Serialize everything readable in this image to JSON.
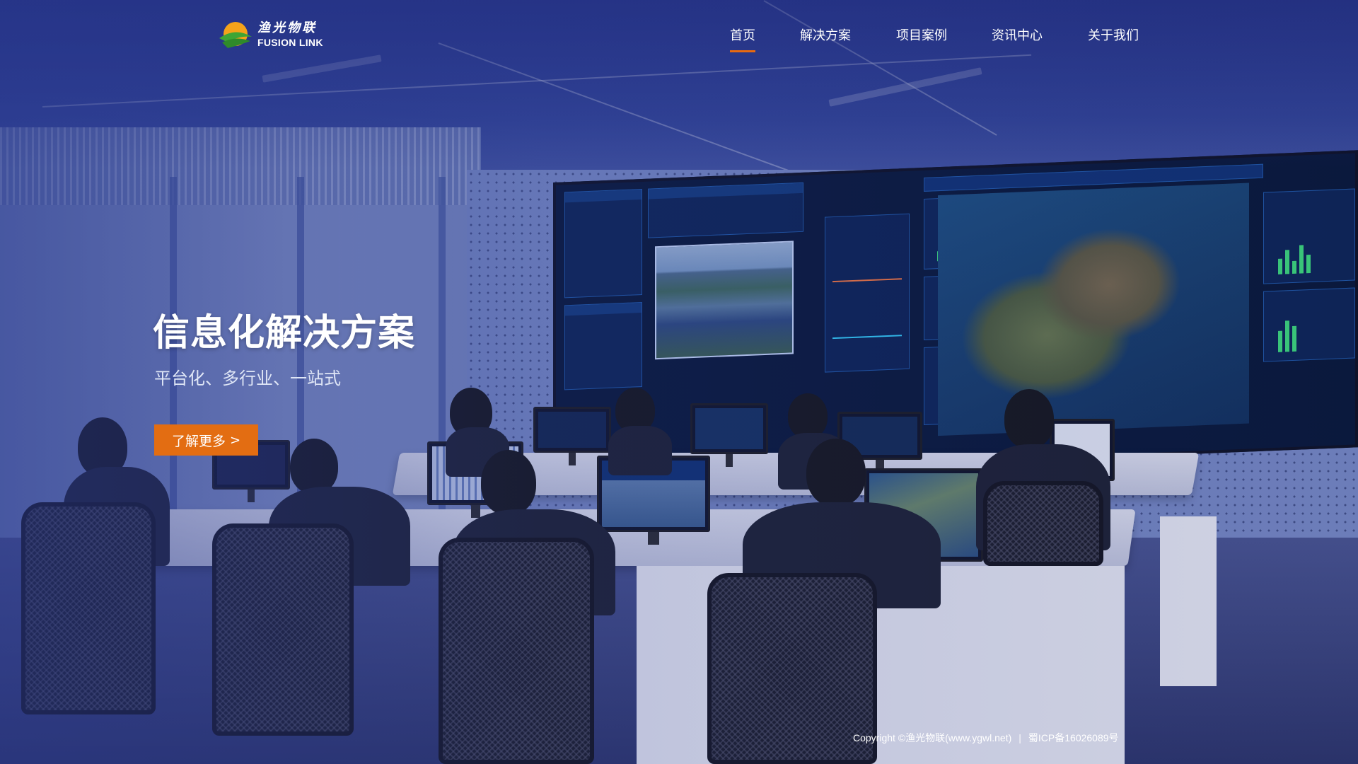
{
  "brand": {
    "name_cn": "渔光物联",
    "name_en": "FUSION LINK",
    "colors": {
      "leaf_green": "#3fa535",
      "sun_orange": "#f5a31a",
      "accent": "#e36d12"
    }
  },
  "nav": {
    "items": [
      {
        "label": "首页",
        "active": true
      },
      {
        "label": "解决方案",
        "active": false
      },
      {
        "label": "项目案例",
        "active": false
      },
      {
        "label": "资讯中心",
        "active": false
      },
      {
        "label": "关于我们",
        "active": false
      }
    ]
  },
  "hero": {
    "title": "信息化解决方案",
    "subtitle": "平台化、多行业、一站式",
    "cta_label": "了解更多",
    "cta_icon": "chevron-right-icon"
  },
  "footer": {
    "copyright": "Copyright ©渔光物联(www.ygwl.net)",
    "separator": "|",
    "icp": "蜀ICP备16026089号"
  }
}
